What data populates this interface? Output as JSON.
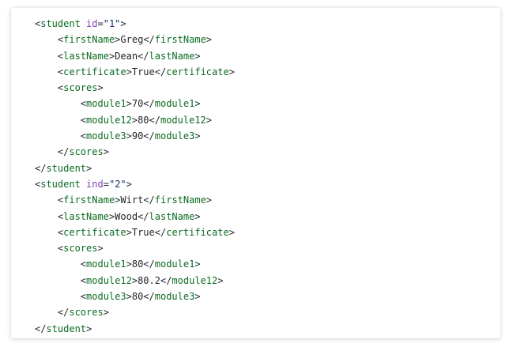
{
  "lines": [
    {
      "indent": 0,
      "type": "open-attr",
      "tag": "student",
      "attr": "id",
      "value": "\"1\""
    },
    {
      "indent": 1,
      "type": "element",
      "tag": "firstName",
      "text": "Greg"
    },
    {
      "indent": 1,
      "type": "element",
      "tag": "lastName",
      "text": "Dean"
    },
    {
      "indent": 1,
      "type": "element",
      "tag": "certificate",
      "text": "True"
    },
    {
      "indent": 1,
      "type": "open",
      "tag": "scores"
    },
    {
      "indent": 2,
      "type": "element",
      "tag": "module1",
      "text": "70"
    },
    {
      "indent": 2,
      "type": "element",
      "tag": "module12",
      "text": "80"
    },
    {
      "indent": 2,
      "type": "element",
      "tag": "module3",
      "text": "90"
    },
    {
      "indent": 1,
      "type": "close",
      "tag": "scores"
    },
    {
      "indent": 0,
      "type": "close",
      "tag": "student"
    },
    {
      "indent": 0,
      "type": "open-attr",
      "tag": "student",
      "attr": "ind",
      "value": "\"2\""
    },
    {
      "indent": 1,
      "type": "element",
      "tag": "firstName",
      "text": "Wirt"
    },
    {
      "indent": 1,
      "type": "element",
      "tag": "lastName",
      "text": "Wood"
    },
    {
      "indent": 1,
      "type": "element",
      "tag": "certificate",
      "text": "True"
    },
    {
      "indent": 1,
      "type": "open",
      "tag": "scores"
    },
    {
      "indent": 2,
      "type": "element",
      "tag": "module1",
      "text": "80"
    },
    {
      "indent": 2,
      "type": "element",
      "tag": "module12",
      "text": "80.2"
    },
    {
      "indent": 2,
      "type": "element",
      "tag": "module3",
      "text": "80"
    },
    {
      "indent": 1,
      "type": "close",
      "tag": "scores"
    },
    {
      "indent": 0,
      "type": "close",
      "tag": "student"
    }
  ],
  "colors": {
    "tag": "#0b6b1f",
    "attribute": "#7a3fb2",
    "string": "#0a2f6b",
    "text": "#1f2328"
  }
}
